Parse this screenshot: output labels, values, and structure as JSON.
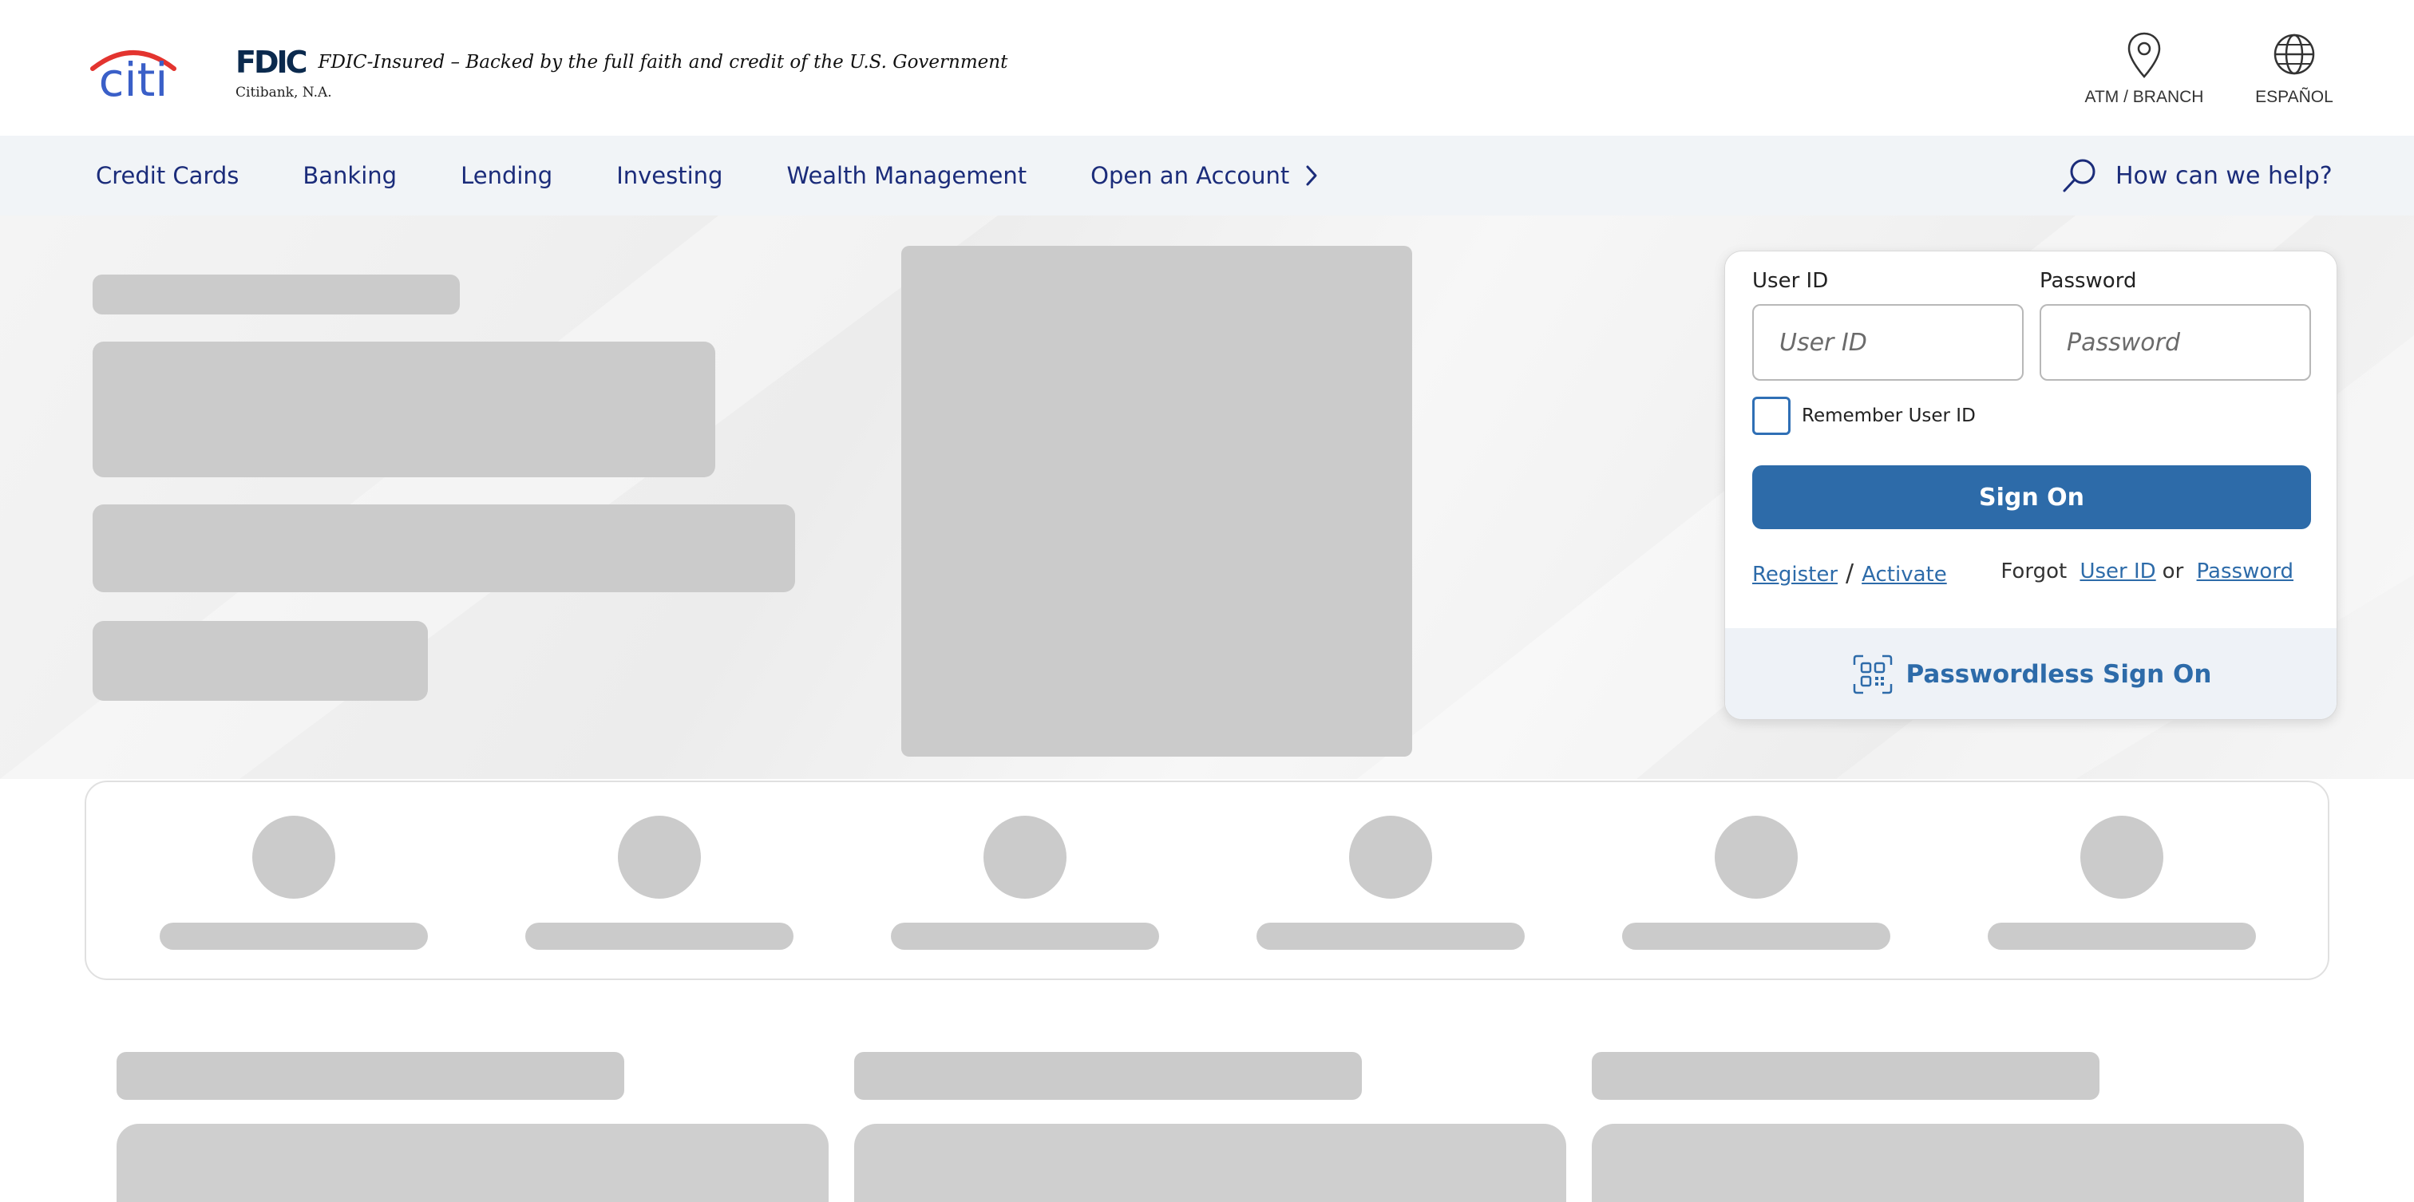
{
  "brand": {
    "logo_text": "citi",
    "fdic_mark": "FDIC",
    "fdic_tagline": "FDIC-Insured – Backed by the full faith and credit of the U.S. Government",
    "fdic_subtext": "Citibank, N.A."
  },
  "utility_links": {
    "atm_label": "ATM / BRANCH",
    "atm_icon": "location-pin-icon",
    "language_label": "ESPAÑOL",
    "language_icon": "globe-icon"
  },
  "nav": {
    "items": [
      {
        "label": "Credit Cards"
      },
      {
        "label": "Banking"
      },
      {
        "label": "Lending"
      },
      {
        "label": "Investing"
      },
      {
        "label": "Wealth Management"
      },
      {
        "label": "Open an Account"
      }
    ],
    "search_label": "How can we help?",
    "search_icon": "search-icon"
  },
  "login": {
    "user_id_label": "User ID",
    "user_id_placeholder": "User ID",
    "password_label": "Password",
    "password_placeholder": "Password",
    "remember_label": "Remember User ID",
    "sign_on_label": "Sign On",
    "register_label": "Register",
    "separator": "/",
    "activate_label": "Activate",
    "forgot_text": "Forgot",
    "forgot_user_id_label": "User ID",
    "or_text": "or",
    "forgot_password_label": "Password",
    "passwordless_label": "Passwordless Sign On",
    "passwordless_icon": "qr-code-icon"
  },
  "colors": {
    "nav_text": "#1b2c7a",
    "primary_button": "#2d6ba9",
    "link": "#2d6ba9",
    "logo_blue": "#3a5fc8",
    "logo_red": "#e3342f",
    "skeleton": "#cbcbcb",
    "nav_background": "#f1f4f7"
  }
}
